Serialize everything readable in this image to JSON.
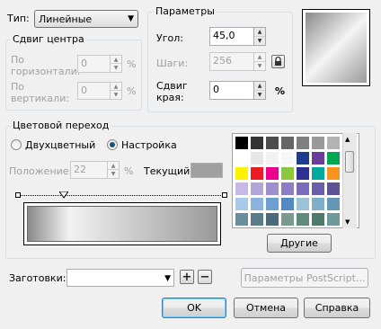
{
  "type": {
    "label": "Тип:",
    "value": "Линейные"
  },
  "center_offset": {
    "title": "Сдвиг центра",
    "horizontal_label_1": "По",
    "horizontal_label_2": "горизонтали:",
    "horizontal_value": "0",
    "vertical_label_1": "По",
    "vertical_label_2": "вертикали:",
    "vertical_value": "0",
    "unit": "%"
  },
  "params": {
    "title": "Параметры",
    "angle_label": "Угол:",
    "angle_value": "45,0",
    "steps_label": "Шаги:",
    "steps_value": "256",
    "edge_label_1": "Сдвиг",
    "edge_label_2": "края:",
    "edge_value": "0",
    "edge_unit": "%"
  },
  "transition": {
    "title": "Цветовой переход",
    "two_color_label": "Двухцветный",
    "custom_label": "Настройка",
    "position_label": "Положение:",
    "position_value": "22",
    "position_unit": "%",
    "current_label": "Текущий:",
    "current_color": "#a0a0a0"
  },
  "palette": {
    "colors": [
      "#000000",
      "#333333",
      "#4d4d4d",
      "#666666",
      "#808080",
      "#999999",
      "#b3b3b3",
      "#cccccc",
      "#ffffff",
      "#e6e6e6",
      "#f2f2f2",
      "#f7f7f7",
      "#1f3c8c",
      "#6a3d9a",
      "#00a651",
      "#00aeef",
      "#fff200",
      "#ed1c24",
      "#ec008c",
      "#8dc63f",
      "#2e3192",
      "#00a99d",
      "#f7941d",
      "#92278f",
      "#c7b8e8",
      "#b3a6d9",
      "#9f8fcf",
      "#8c7ec6",
      "#7a6bbd",
      "#6a5fa8",
      "#5c5294",
      "#4e4680",
      "#a9c9e8",
      "#8bb3dd",
      "#6e9fd1",
      "#5089c4",
      "#9bc2d6",
      "#7faec8",
      "#6497b5",
      "#4d81a0",
      "#6b8e9f",
      "#5a7d8c",
      "#4a6c7a",
      "#7a9a8f",
      "#5f8a7c",
      "#4f7a6b",
      "#6f9a9a",
      "#5a8c8c"
    ],
    "others_button": "Другие"
  },
  "presets": {
    "label": "Заготовки:",
    "value": ""
  },
  "postscript_button": "Параметры PostScript...",
  "buttons": {
    "ok": "OK",
    "cancel": "Отмена",
    "help": "Справка"
  },
  "gradient": {
    "from": "#8a8a8a",
    "mid": "#f2f2f2",
    "to": "#9a9a9a",
    "stop_position_percent": 22
  }
}
